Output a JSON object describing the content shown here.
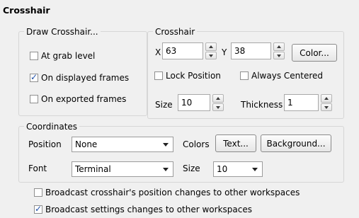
{
  "title": "Crosshair",
  "draw_crosshair": {
    "legend": "Draw Crosshair...",
    "at_grab_level": {
      "label": "At grab level",
      "checked": false
    },
    "on_displayed_frames": {
      "label": "On displayed frames",
      "checked": true
    },
    "on_exported_frames": {
      "label": "On exported frames",
      "checked": false
    }
  },
  "crosshair": {
    "legend": "Crosshair",
    "x_label": "X",
    "x_value": "63",
    "y_label": "Y",
    "y_value": "38",
    "color_button": "Color...",
    "lock_position": {
      "label": "Lock Position",
      "checked": false
    },
    "always_centered": {
      "label": "Always Centered",
      "checked": false
    },
    "size_label": "Size",
    "size_value": "10",
    "thickness_label": "Thickness",
    "thickness_value": "1"
  },
  "coordinates": {
    "legend": "Coordinates",
    "position_label": "Position",
    "position_value": "None",
    "colors_label": "Colors",
    "text_button": "Text...",
    "background_button": "Background...",
    "font_label": "Font",
    "font_value": "Terminal",
    "size_label": "Size",
    "size_value": "10"
  },
  "broadcast_position": {
    "label": "Broadcast crosshair's position changes to other workspaces",
    "checked": false
  },
  "broadcast_settings": {
    "label": "Broadcast settings changes to other workspaces",
    "checked": true
  }
}
